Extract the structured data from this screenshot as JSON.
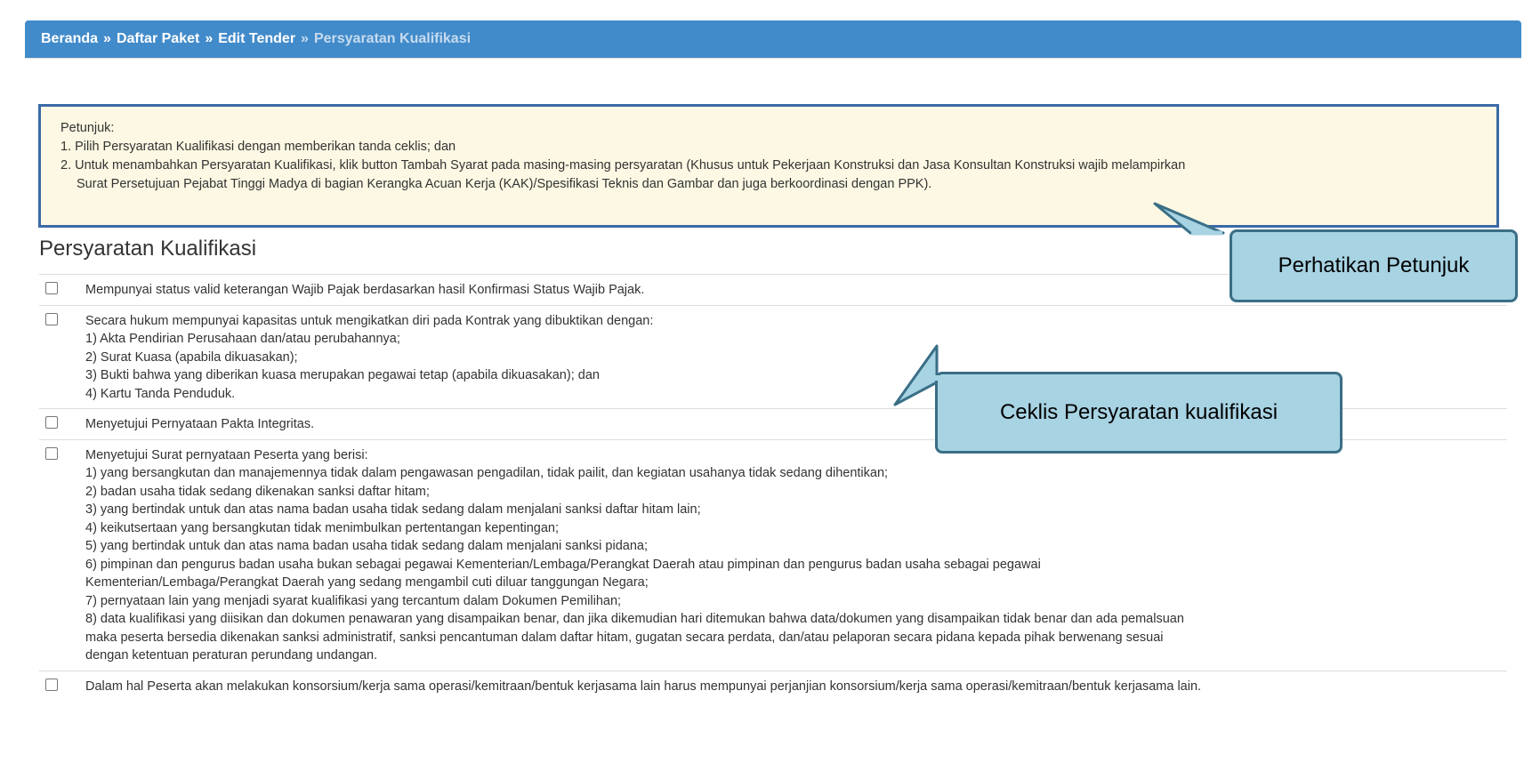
{
  "breadcrumb": {
    "items": [
      "Beranda",
      "Daftar Paket",
      "Edit Tender"
    ],
    "current": "Persyaratan Kualifikasi",
    "separator": "»"
  },
  "instructions": {
    "heading": "Petunjuk:",
    "line1": "1. Pilih Persyaratan Kualifikasi dengan memberikan tanda ceklis; dan",
    "line2a": "2. Untuk menambahkan Persyaratan Kualifikasi, klik button Tambah Syarat pada masing-masing persyaratan (Khusus untuk Pekerjaan Konstruksi dan Jasa Konsultan Konstruksi wajib melampirkan",
    "line2b": "Surat Persetujuan Pejabat Tinggi Madya di bagian Kerangka Acuan Kerja (KAK)/Spesifikasi Teknis dan Gambar dan juga berkoordinasi dengan PPK)."
  },
  "section_title": "Persyaratan Kualifikasi",
  "requirements": [
    {
      "lines": [
        "Mempunyai status valid keterangan Wajib Pajak berdasarkan hasil Konfirmasi Status Wajib Pajak."
      ],
      "checked": false
    },
    {
      "lines": [
        "Secara hukum mempunyai kapasitas untuk mengikatkan diri pada Kontrak yang dibuktikan dengan:",
        "1) Akta Pendirian Perusahaan dan/atau perubahannya;",
        "2) Surat Kuasa (apabila dikuasakan);",
        "3) Bukti bahwa yang diberikan kuasa merupakan pegawai tetap (apabila dikuasakan); dan",
        "4) Kartu Tanda Penduduk."
      ],
      "checked": false
    },
    {
      "lines": [
        "Menyetujui Pernyataan Pakta Integritas."
      ],
      "checked": false
    },
    {
      "lines": [
        "Menyetujui Surat pernyataan Peserta yang berisi:",
        "1) yang bersangkutan dan manajemennya tidak dalam pengawasan pengadilan, tidak pailit, dan kegiatan usahanya tidak sedang dihentikan;",
        "2) badan usaha tidak sedang dikenakan sanksi daftar hitam;",
        "3) yang bertindak untuk dan atas nama badan usaha tidak sedang dalam menjalani sanksi daftar hitam lain;",
        "4) keikutsertaan yang bersangkutan tidak menimbulkan pertentangan kepentingan;",
        "5) yang bertindak untuk dan atas nama badan usaha tidak sedang dalam menjalani sanksi pidana;",
        "6) pimpinan dan pengurus badan usaha bukan sebagai pegawai Kementerian/Lembaga/Perangkat Daerah atau pimpinan dan pengurus badan usaha sebagai pegawai",
        "Kementerian/Lembaga/Perangkat Daerah yang sedang mengambil cuti diluar tanggungan Negara;",
        "7) pernyataan lain yang menjadi syarat kualifikasi yang tercantum dalam Dokumen Pemilihan;",
        "8) data kualifikasi yang diisikan dan dokumen penawaran yang disampaikan benar, dan jika dikemudian hari ditemukan bahwa data/dokumen yang disampaikan tidak benar dan ada pemalsuan",
        "maka peserta bersedia dikenakan sanksi administratif, sanksi pencantuman dalam daftar hitam, gugatan secara perdata, dan/atau pelaporan secara pidana kepada pihak berwenang sesuai",
        "dengan ketentuan peraturan perundang undangan."
      ],
      "checked": false
    },
    {
      "lines": [
        "Dalam hal Peserta akan melakukan konsorsium/kerja sama operasi/kemitraan/bentuk kerjasama lain harus mempunyai perjanjian konsorsium/kerja sama operasi/kemitraan/bentuk kerjasama lain."
      ],
      "checked": false
    }
  ],
  "callouts": {
    "petunjuk": "Perhatikan Petunjuk",
    "ceklis": "Ceklis Persyaratan kualifikasi"
  },
  "colors": {
    "breadcrumb_bg": "#428bca",
    "instructions_bg": "#fcf8e3",
    "instructions_border": "#3b6aa6",
    "callout_bg": "#a7d3e3",
    "callout_border": "#3a6f86"
  }
}
